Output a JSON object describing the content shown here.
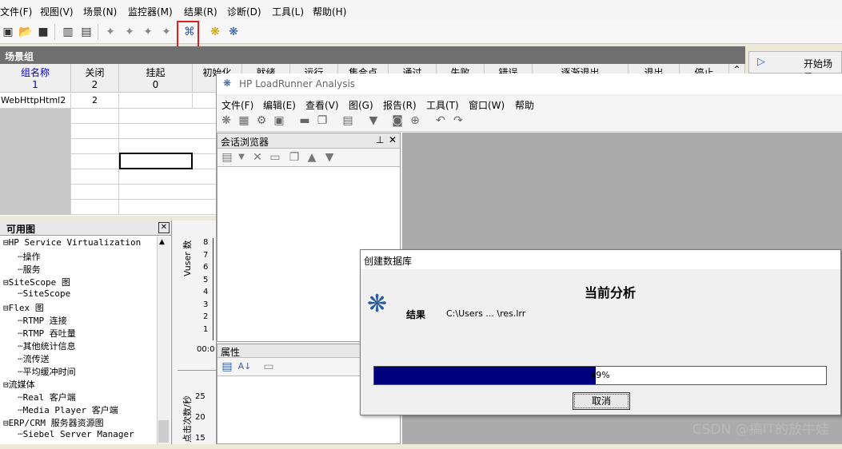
{
  "controller": {
    "menu": [
      "文件(F)",
      "视图(V)",
      "场景(N)",
      "监控器(M)",
      "结果(R)",
      "诊断(D)",
      "工具(L)",
      "帮助(H)"
    ],
    "scenario_group_title": "场景组",
    "columns": [
      {
        "label": "组名称",
        "count": "1"
      },
      {
        "label": "关闭",
        "count": "2"
      },
      {
        "label": "挂起",
        "count": "0"
      },
      {
        "label": "初始化",
        "count": ""
      },
      {
        "label": "就绪",
        "count": ""
      },
      {
        "label": "运行",
        "count": ""
      },
      {
        "label": "集合点",
        "count": ""
      },
      {
        "label": "通过",
        "count": ""
      },
      {
        "label": "失败",
        "count": ""
      },
      {
        "label": "错误",
        "count": ""
      },
      {
        "label": "逐渐退出",
        "count": ""
      },
      {
        "label": "退出",
        "count": ""
      },
      {
        "label": "停止",
        "count": ""
      }
    ],
    "row1": {
      "name": "WebHttpHtml2",
      "closed": "2"
    },
    "start_button": "开始场景",
    "available_graphs": {
      "title": "可用图",
      "items": [
        "HP Service Virtualization",
        "操作",
        "服务",
        "SiteScope 图",
        "SiteScope",
        "Flex 图",
        "RTMP 连接",
        "RTMP 吞吐量",
        "其他统计信息",
        "流传送",
        "平均缓冲时间",
        "流媒体",
        "Real 客户端",
        "Media Player 客户端",
        "ERP/CRM 服务器资源图",
        "Siebel Server Manager"
      ]
    },
    "chart1": {
      "ylabel": "Vuser 数",
      "ticks": [
        "8",
        "7",
        "6",
        "5",
        "4",
        "3",
        "2",
        "1"
      ],
      "time": "00:0"
    },
    "chart2": {
      "ylabel": "点击次数/秒",
      "ticks": [
        "25",
        "20",
        "15"
      ]
    }
  },
  "analysis": {
    "title": "HP LoadRunner Analysis",
    "menu": [
      "文件(F)",
      "编辑(E)",
      "查看(V)",
      "图(G)",
      "报告(R)",
      "工具(T)",
      "窗口(W)",
      "帮助"
    ],
    "session_browser": "会话浏览器",
    "properties": "属性"
  },
  "dialog": {
    "title": "创建数据库",
    "heading": "当前分析",
    "result_label": "结果",
    "result_path": "C:\\Users ... \\res.lrr",
    "progress_percent": 49,
    "progress_text": "49%",
    "cancel": "取消"
  },
  "watermark": "CSDN @搞IT的放牛娃",
  "colors": {
    "progress": "#00007f",
    "highlight_box": "#e02020",
    "header_blue": "#0000cc"
  }
}
